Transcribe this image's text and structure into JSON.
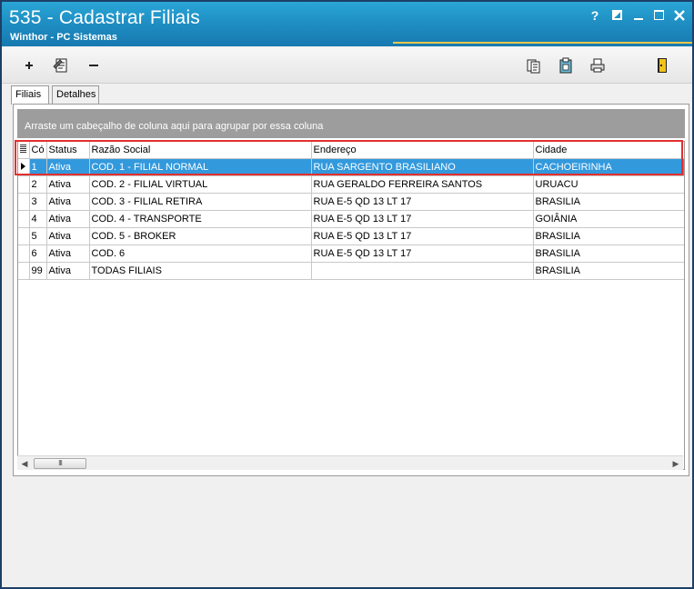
{
  "window": {
    "title": "535 - Cadastrar Filiais",
    "subtitle": "Winthor - PC Sistemas",
    "controls": {
      "help": "?"
    }
  },
  "toolbar": {
    "icons": [
      "add-icon",
      "edit-document-icon",
      "remove-icon",
      "copy-icon",
      "clipboard-icon",
      "print-icon",
      "exit-door-icon"
    ]
  },
  "tabs": [
    {
      "label": "Filiais",
      "active": true
    },
    {
      "label": "Detalhes",
      "active": false
    }
  ],
  "grid": {
    "group_hint": "Arraste um cabeçalho de coluna aqui para agrupar por essa coluna",
    "columns": [
      "Có",
      "Status",
      "Razão Social",
      "Endereço",
      "Cidade"
    ],
    "rows": [
      {
        "cod": "1",
        "status": "Ativa",
        "razao": "COD. 1 - FILIAL NORMAL",
        "endereco": "RUA SARGENTO BRASILIANO",
        "cidade": "CACHOEIRINHA",
        "selected": true
      },
      {
        "cod": "2",
        "status": "Ativa",
        "razao": "COD. 2 - FILIAL VIRTUAL",
        "endereco": "RUA GERALDO FERREIRA SANTOS",
        "cidade": "URUACU"
      },
      {
        "cod": "3",
        "status": "Ativa",
        "razao": "COD. 3 - FILIAL RETIRA",
        "endereco": "RUA E-5 QD 13 LT 17",
        "cidade": "BRASILIA"
      },
      {
        "cod": "4",
        "status": "Ativa",
        "razao": "COD. 4 - TRANSPORTE",
        "endereco": "RUA E-5 QD 13 LT 17",
        "cidade": "GOIÂNIA"
      },
      {
        "cod": "5",
        "status": "Ativa",
        "razao": "COD. 5 - BROKER",
        "endereco": "RUA E-5 QD 13 LT 17",
        "cidade": "BRASILIA"
      },
      {
        "cod": "6",
        "status": "Ativa",
        "razao": "COD. 6",
        "endereco": "RUA E-5 QD 13 LT 17",
        "cidade": "BRASILIA"
      },
      {
        "cod": "99",
        "status": "Ativa",
        "razao": "TODAS FILIAIS",
        "endereco": "",
        "cidade": "BRASILIA"
      }
    ],
    "scroll_thumb_text": "III"
  },
  "colors": {
    "title_bar": "#1f8fc4",
    "selection": "#3399dd",
    "highlight_frame": "#e03030",
    "group_bar": "#9d9d9d"
  }
}
